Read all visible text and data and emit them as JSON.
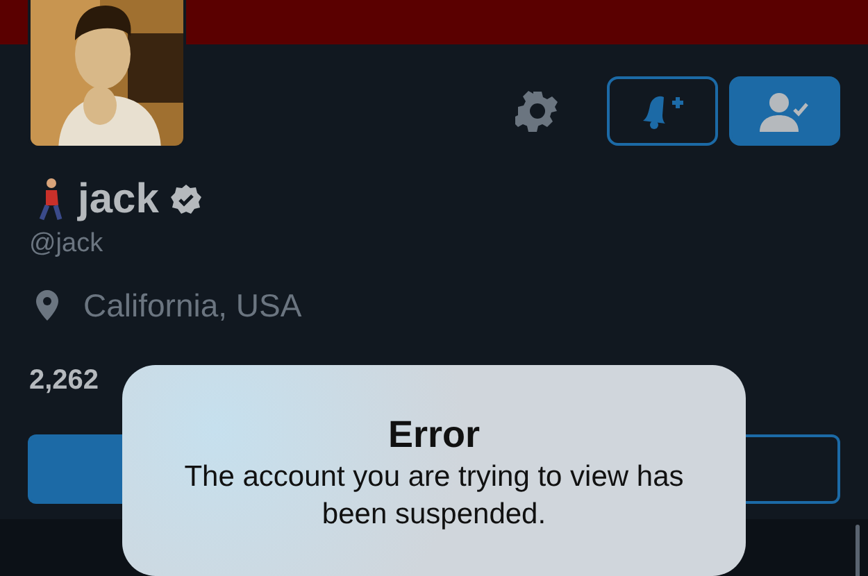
{
  "profile": {
    "name": "jack",
    "verified": true,
    "handle": "@jack",
    "location": "California, USA"
  },
  "stats": [
    {
      "count": "2,262"
    }
  ],
  "follow_button": {
    "selected": true
  },
  "dialog": {
    "title": "Error",
    "message": "The account you are trying to view has been suspended."
  }
}
